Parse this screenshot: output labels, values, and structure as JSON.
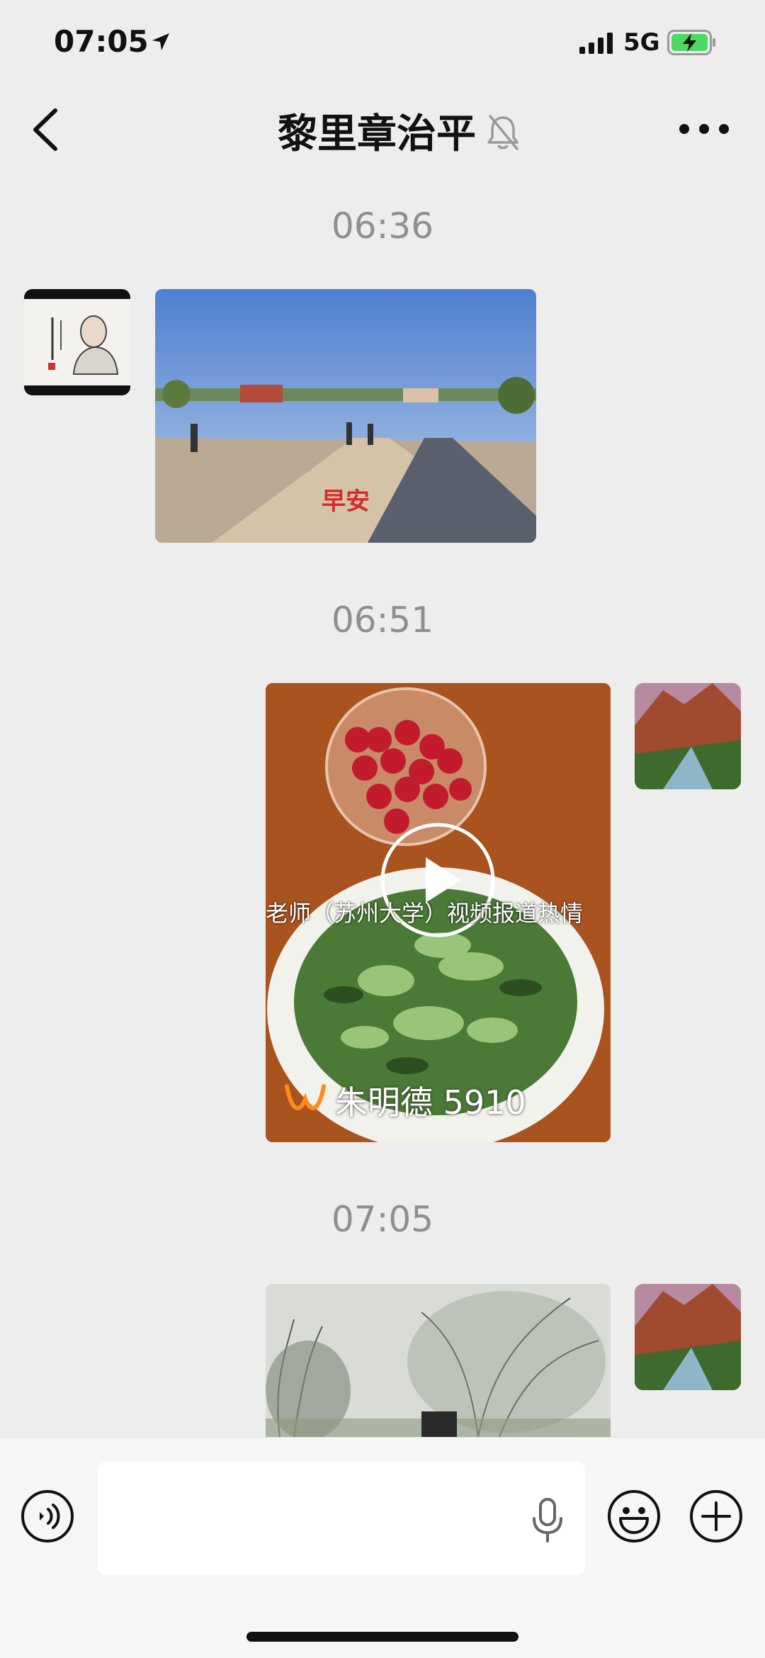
{
  "status": {
    "time": "07:05",
    "network": "5G",
    "battery_charging": true
  },
  "nav": {
    "title": "黎里章治平",
    "muted": true
  },
  "messages": [
    {
      "timestamp": "06:36",
      "sender": "contact",
      "type": "image",
      "caption": "早安"
    },
    {
      "timestamp": "06:51",
      "sender": "self",
      "type": "video",
      "overlay_text": "老师（苏州大学）视频报道热情",
      "watermark": "朱明德 5910"
    },
    {
      "timestamp": "07:05",
      "sender": "self",
      "type": "video"
    }
  ],
  "colors": {
    "background": "#ededed",
    "timestamp": "#8f8f8f",
    "caption": "#d62b2b",
    "accent": "#4cd964"
  },
  "icons": [
    "back-icon",
    "mute-bell-icon",
    "more-icon",
    "voice-icon",
    "mic-icon",
    "emoji-icon",
    "plus-icon",
    "play-icon"
  ]
}
